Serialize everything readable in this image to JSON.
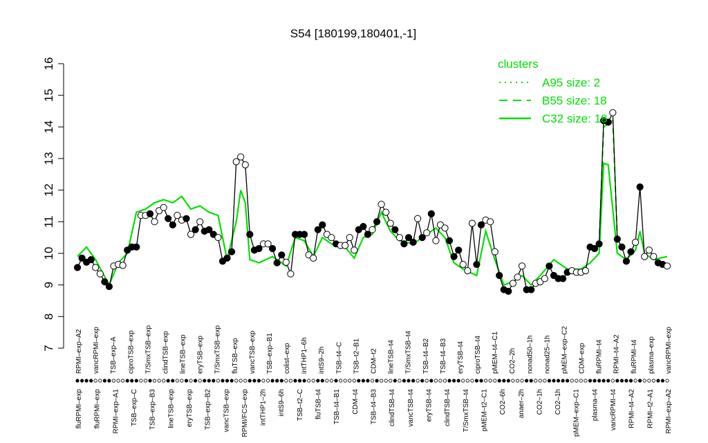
{
  "chart_data": {
    "type": "line",
    "title": "S54 [180199,180401,-1]",
    "xlabel": "",
    "ylabel": "",
    "ylim": [
      7,
      16
    ],
    "yticks": [
      7,
      8,
      9,
      10,
      11,
      12,
      13,
      14,
      15,
      16
    ],
    "grid": false,
    "legend": {
      "title": "clusters",
      "placement": "top-right",
      "entries": [
        {
          "label": "A95 size: 2",
          "style": "dotted"
        },
        {
          "label": "B55 size: 18",
          "style": "dashed"
        },
        {
          "label": "C32 size: 18",
          "style": "solid"
        }
      ]
    },
    "colors": {
      "cluster_line": "#00e000",
      "black_line": "#000000"
    },
    "tick_labels_top": [
      "RPMI–exp–A2",
      "vancRPMI–exp",
      "TSB–exp–A",
      "ciproTSB–exp",
      "T/SmxTSB–exp",
      "clindTSB–exp",
      "lineTSB–exp",
      "eryTSB–exp",
      "T/SmxTSB–exp",
      "fluTSB–exp",
      "vancTSB–exp",
      "TSB–exp–B1",
      "colist–exp",
      "intTHP1–6h",
      "intS9–2h",
      "TSB–t4–C",
      "TSB–t2–B1",
      "CDM–t2",
      "lineTSB–t4",
      "T/SmxTSB–t4",
      "TSB–t4–B2",
      "TSB–t4–B3",
      "eryTSB–t4",
      "ciproTSB–t4",
      "pMEM–t4–C1",
      "CO2–2h",
      "nonad50–1h",
      "nonad25–1h",
      "pMEM–exp–C2",
      "CDM–exp",
      "fluRPMI–t4",
      "RPMI–t4–A2",
      "fluRPMI–t4",
      "plasma–exp",
      "vancRPMI–exp"
    ],
    "tick_labels_bottom": [
      "fluRPMI–exp",
      "fluRPMI–exp",
      "RPMI–exp–A1",
      "TSB–exp–C",
      "TSB–exp–B3",
      "lineTSB–exp",
      "eryTSB–exp",
      "TSB–exp–B2",
      "vancTSB–exp",
      "RPMI/FCS–exp",
      "intTHP1–2h",
      "intS9–6h",
      "TSB–t2–C",
      "fluTSB–t4",
      "TSB–t4–B1",
      "CDM–t4",
      "TSB–t4–B3",
      "clindTSB–t4",
      "vancTSB–t4",
      "eryTSB–t4",
      "clindTSB–t4",
      "T/SmxTSB–t4",
      "pMEM–t2–C1",
      "CO2–6h",
      "anaer–2h",
      "CO2–1h",
      "CO2–1h",
      "pMEM–exp–C1",
      "plasma–t4",
      "vancRPMI–t4",
      "RPMI–t4–A2",
      "RPMI–t2–A1",
      "RPMI–exp–A2"
    ],
    "points": [
      {
        "x": 1,
        "y": 9.55,
        "filled": true
      },
      {
        "x": 2,
        "y": 9.85,
        "filled": true
      },
      {
        "x": 3,
        "y": 9.72,
        "filled": true
      },
      {
        "x": 4,
        "y": 9.8,
        "filled": true
      },
      {
        "x": 5,
        "y": 9.55,
        "filled": false
      },
      {
        "x": 6,
        "y": 9.35,
        "filled": false
      },
      {
        "x": 7,
        "y": 9.1,
        "filled": true
      },
      {
        "x": 8,
        "y": 8.95,
        "filled": true
      },
      {
        "x": 9,
        "y": 9.6,
        "filled": false
      },
      {
        "x": 10,
        "y": 9.65,
        "filled": false
      },
      {
        "x": 11,
        "y": 9.62,
        "filled": false
      },
      {
        "x": 12,
        "y": 10.1,
        "filled": true
      },
      {
        "x": 13,
        "y": 10.2,
        "filled": true
      },
      {
        "x": 14,
        "y": 10.2,
        "filled": true
      },
      {
        "x": 15,
        "y": 11.2,
        "filled": false
      },
      {
        "x": 16,
        "y": 11.2,
        "filled": false
      },
      {
        "x": 17,
        "y": 11.25,
        "filled": true
      },
      {
        "x": 18,
        "y": 11.0,
        "filled": false
      },
      {
        "x": 19,
        "y": 11.35,
        "filled": false
      },
      {
        "x": 20,
        "y": 11.45,
        "filled": false
      },
      {
        "x": 21,
        "y": 11.1,
        "filled": true
      },
      {
        "x": 22,
        "y": 10.9,
        "filled": true
      },
      {
        "x": 23,
        "y": 11.2,
        "filled": false
      },
      {
        "x": 24,
        "y": 11.05,
        "filled": false
      },
      {
        "x": 25,
        "y": 11.1,
        "filled": true
      },
      {
        "x": 26,
        "y": 10.6,
        "filled": false
      },
      {
        "x": 27,
        "y": 10.75,
        "filled": true
      },
      {
        "x": 28,
        "y": 11.0,
        "filled": false
      },
      {
        "x": 29,
        "y": 10.7,
        "filled": true
      },
      {
        "x": 30,
        "y": 10.75,
        "filled": true
      },
      {
        "x": 31,
        "y": 10.6,
        "filled": true
      },
      {
        "x": 32,
        "y": 10.5,
        "filled": false
      },
      {
        "x": 33,
        "y": 9.75,
        "filled": true
      },
      {
        "x": 34,
        "y": 9.85,
        "filled": true
      },
      {
        "x": 35,
        "y": 10.05,
        "filled": true
      },
      {
        "x": 36,
        "y": 12.9,
        "filled": false
      },
      {
        "x": 37,
        "y": 13.05,
        "filled": false
      },
      {
        "x": 38,
        "y": 12.8,
        "filled": false
      },
      {
        "x": 39,
        "y": 10.6,
        "filled": true
      },
      {
        "x": 40,
        "y": 10.1,
        "filled": true
      },
      {
        "x": 41,
        "y": 10.15,
        "filled": true
      },
      {
        "x": 42,
        "y": 10.3,
        "filled": false
      },
      {
        "x": 43,
        "y": 10.3,
        "filled": false
      },
      {
        "x": 44,
        "y": 10.15,
        "filled": true
      },
      {
        "x": 45,
        "y": 9.7,
        "filled": true
      },
      {
        "x": 46,
        "y": 9.95,
        "filled": true
      },
      {
        "x": 47,
        "y": 9.72,
        "filled": false
      },
      {
        "x": 48,
        "y": 9.35,
        "filled": false
      },
      {
        "x": 49,
        "y": 10.6,
        "filled": true
      },
      {
        "x": 50,
        "y": 10.6,
        "filled": true
      },
      {
        "x": 51,
        "y": 10.6,
        "filled": true
      },
      {
        "x": 52,
        "y": 9.95,
        "filled": false
      },
      {
        "x": 53,
        "y": 9.85,
        "filled": false
      },
      {
        "x": 54,
        "y": 10.75,
        "filled": true
      },
      {
        "x": 55,
        "y": 10.9,
        "filled": true
      },
      {
        "x": 56,
        "y": 10.6,
        "filled": false
      },
      {
        "x": 57,
        "y": 10.5,
        "filled": false
      },
      {
        "x": 58,
        "y": 10.3,
        "filled": true
      },
      {
        "x": 59,
        "y": 10.25,
        "filled": false
      },
      {
        "x": 60,
        "y": 10.25,
        "filled": false
      },
      {
        "x": 61,
        "y": 10.5,
        "filled": false
      },
      {
        "x": 62,
        "y": 10.1,
        "filled": false
      },
      {
        "x": 63,
        "y": 10.75,
        "filled": true
      },
      {
        "x": 64,
        "y": 10.85,
        "filled": true
      },
      {
        "x": 65,
        "y": 10.6,
        "filled": true
      },
      {
        "x": 66,
        "y": 10.75,
        "filled": false
      },
      {
        "x": 67,
        "y": 11.0,
        "filled": true
      },
      {
        "x": 68,
        "y": 11.55,
        "filled": false
      },
      {
        "x": 69,
        "y": 11.3,
        "filled": false
      },
      {
        "x": 70,
        "y": 10.95,
        "filled": false
      },
      {
        "x": 71,
        "y": 10.75,
        "filled": true
      },
      {
        "x": 72,
        "y": 10.5,
        "filled": false
      },
      {
        "x": 73,
        "y": 10.3,
        "filled": true
      },
      {
        "x": 74,
        "y": 10.5,
        "filled": true
      },
      {
        "x": 75,
        "y": 10.35,
        "filled": true
      },
      {
        "x": 76,
        "y": 11.1,
        "filled": false
      },
      {
        "x": 77,
        "y": 10.5,
        "filled": true
      },
      {
        "x": 78,
        "y": 10.65,
        "filled": false
      },
      {
        "x": 79,
        "y": 11.25,
        "filled": true
      },
      {
        "x": 80,
        "y": 10.4,
        "filled": false
      },
      {
        "x": 81,
        "y": 10.9,
        "filled": false
      },
      {
        "x": 82,
        "y": 10.8,
        "filled": false
      },
      {
        "x": 83,
        "y": 10.4,
        "filled": true
      },
      {
        "x": 84,
        "y": 9.9,
        "filled": true
      },
      {
        "x": 85,
        "y": 10.1,
        "filled": true
      },
      {
        "x": 86,
        "y": 9.65,
        "filled": false
      },
      {
        "x": 87,
        "y": 9.45,
        "filled": false
      },
      {
        "x": 88,
        "y": 10.95,
        "filled": false
      },
      {
        "x": 89,
        "y": 9.65,
        "filled": true
      },
      {
        "x": 90,
        "y": 10.9,
        "filled": true
      },
      {
        "x": 91,
        "y": 11.05,
        "filled": false
      },
      {
        "x": 92,
        "y": 11.0,
        "filled": false
      },
      {
        "x": 93,
        "y": 10.05,
        "filled": false
      },
      {
        "x": 94,
        "y": 9.3,
        "filled": true
      },
      {
        "x": 95,
        "y": 8.85,
        "filled": true
      },
      {
        "x": 96,
        "y": 8.8,
        "filled": true
      },
      {
        "x": 97,
        "y": 9.05,
        "filled": false
      },
      {
        "x": 98,
        "y": 9.25,
        "filled": false
      },
      {
        "x": 99,
        "y": 9.6,
        "filled": false
      },
      {
        "x": 100,
        "y": 8.85,
        "filled": true
      },
      {
        "x": 101,
        "y": 8.85,
        "filled": true
      },
      {
        "x": 102,
        "y": 9.05,
        "filled": false
      },
      {
        "x": 103,
        "y": 9.1,
        "filled": false
      },
      {
        "x": 104,
        "y": 9.2,
        "filled": false
      },
      {
        "x": 105,
        "y": 9.6,
        "filled": true
      },
      {
        "x": 106,
        "y": 9.3,
        "filled": true
      },
      {
        "x": 107,
        "y": 9.2,
        "filled": true
      },
      {
        "x": 108,
        "y": 9.2,
        "filled": true
      },
      {
        "x": 109,
        "y": 9.4,
        "filled": true
      },
      {
        "x": 110,
        "y": 9.45,
        "filled": false
      },
      {
        "x": 111,
        "y": 9.4,
        "filled": false
      },
      {
        "x": 112,
        "y": 9.4,
        "filled": false
      },
      {
        "x": 113,
        "y": 9.45,
        "filled": false
      },
      {
        "x": 114,
        "y": 10.2,
        "filled": true
      },
      {
        "x": 115,
        "y": 10.15,
        "filled": true
      },
      {
        "x": 116,
        "y": 10.3,
        "filled": true
      },
      {
        "x": 117,
        "y": 14.2,
        "filled": true
      },
      {
        "x": 118,
        "y": 14.15,
        "filled": true
      },
      {
        "x": 119,
        "y": 14.45,
        "filled": false
      },
      {
        "x": 120,
        "y": 10.45,
        "filled": true
      },
      {
        "x": 121,
        "y": 10.2,
        "filled": true
      },
      {
        "x": 122,
        "y": 9.75,
        "filled": true
      },
      {
        "x": 123,
        "y": 10.05,
        "filled": true
      },
      {
        "x": 124,
        "y": 10.35,
        "filled": false
      },
      {
        "x": 125,
        "y": 12.1,
        "filled": true
      },
      {
        "x": 126,
        "y": 9.9,
        "filled": false
      },
      {
        "x": 127,
        "y": 10.1,
        "filled": false
      },
      {
        "x": 128,
        "y": 9.9,
        "filled": false
      },
      {
        "x": 129,
        "y": 9.7,
        "filled": true
      },
      {
        "x": 130,
        "y": 9.65,
        "filled": true
      },
      {
        "x": 131,
        "y": 9.6,
        "filled": false
      }
    ],
    "cluster_line": [
      {
        "x": 1,
        "y": 9.9
      },
      {
        "x": 3,
        "y": 10.2
      },
      {
        "x": 5,
        "y": 9.8
      },
      {
        "x": 8,
        "y": 9.0
      },
      {
        "x": 10,
        "y": 9.7
      },
      {
        "x": 12,
        "y": 10.0
      },
      {
        "x": 14,
        "y": 11.3
      },
      {
        "x": 16,
        "y": 11.4
      },
      {
        "x": 18,
        "y": 11.6
      },
      {
        "x": 20,
        "y": 11.7
      },
      {
        "x": 22,
        "y": 11.6
      },
      {
        "x": 24,
        "y": 11.8
      },
      {
        "x": 26,
        "y": 11.4
      },
      {
        "x": 28,
        "y": 11.5
      },
      {
        "x": 30,
        "y": 11.3
      },
      {
        "x": 32,
        "y": 11.2
      },
      {
        "x": 34,
        "y": 9.8
      },
      {
        "x": 36,
        "y": 11.0
      },
      {
        "x": 37,
        "y": 12.0
      },
      {
        "x": 38,
        "y": 11.6
      },
      {
        "x": 39,
        "y": 9.8
      },
      {
        "x": 41,
        "y": 9.7
      },
      {
        "x": 44,
        "y": 9.9
      },
      {
        "x": 47,
        "y": 9.6
      },
      {
        "x": 49,
        "y": 10.5
      },
      {
        "x": 51,
        "y": 10.4
      },
      {
        "x": 53,
        "y": 9.9
      },
      {
        "x": 55,
        "y": 10.5
      },
      {
        "x": 57,
        "y": 10.3
      },
      {
        "x": 60,
        "y": 10.2
      },
      {
        "x": 62,
        "y": 9.85
      },
      {
        "x": 64,
        "y": 10.5
      },
      {
        "x": 66,
        "y": 10.6
      },
      {
        "x": 68,
        "y": 11.3
      },
      {
        "x": 70,
        "y": 10.7
      },
      {
        "x": 72,
        "y": 10.4
      },
      {
        "x": 75,
        "y": 10.3
      },
      {
        "x": 78,
        "y": 10.6
      },
      {
        "x": 80,
        "y": 10.8
      },
      {
        "x": 82,
        "y": 10.5
      },
      {
        "x": 84,
        "y": 9.7
      },
      {
        "x": 86,
        "y": 9.5
      },
      {
        "x": 89,
        "y": 9.3
      },
      {
        "x": 91,
        "y": 10.7
      },
      {
        "x": 93,
        "y": 9.8
      },
      {
        "x": 95,
        "y": 9.0
      },
      {
        "x": 97,
        "y": 9.1
      },
      {
        "x": 99,
        "y": 9.3
      },
      {
        "x": 101,
        "y": 9.0
      },
      {
        "x": 103,
        "y": 9.3
      },
      {
        "x": 106,
        "y": 9.8
      },
      {
        "x": 109,
        "y": 9.5
      },
      {
        "x": 112,
        "y": 9.5
      },
      {
        "x": 114,
        "y": 9.7
      },
      {
        "x": 116,
        "y": 10.0
      },
      {
        "x": 117,
        "y": 12.85
      },
      {
        "x": 118,
        "y": 12.8
      },
      {
        "x": 120,
        "y": 10.0
      },
      {
        "x": 122,
        "y": 9.8
      },
      {
        "x": 124,
        "y": 10.1
      },
      {
        "x": 125,
        "y": 10.7
      },
      {
        "x": 126,
        "y": 10.0
      },
      {
        "x": 128,
        "y": 9.8
      },
      {
        "x": 131,
        "y": 9.9
      }
    ],
    "dashed_segment": [
      {
        "x": 116,
        "y": 10.3
      },
      {
        "x": 117,
        "y": 14.0
      },
      {
        "x": 118,
        "y": 14.1
      },
      {
        "x": 119,
        "y": 14.2
      },
      {
        "x": 120,
        "y": 10.5
      }
    ]
  }
}
